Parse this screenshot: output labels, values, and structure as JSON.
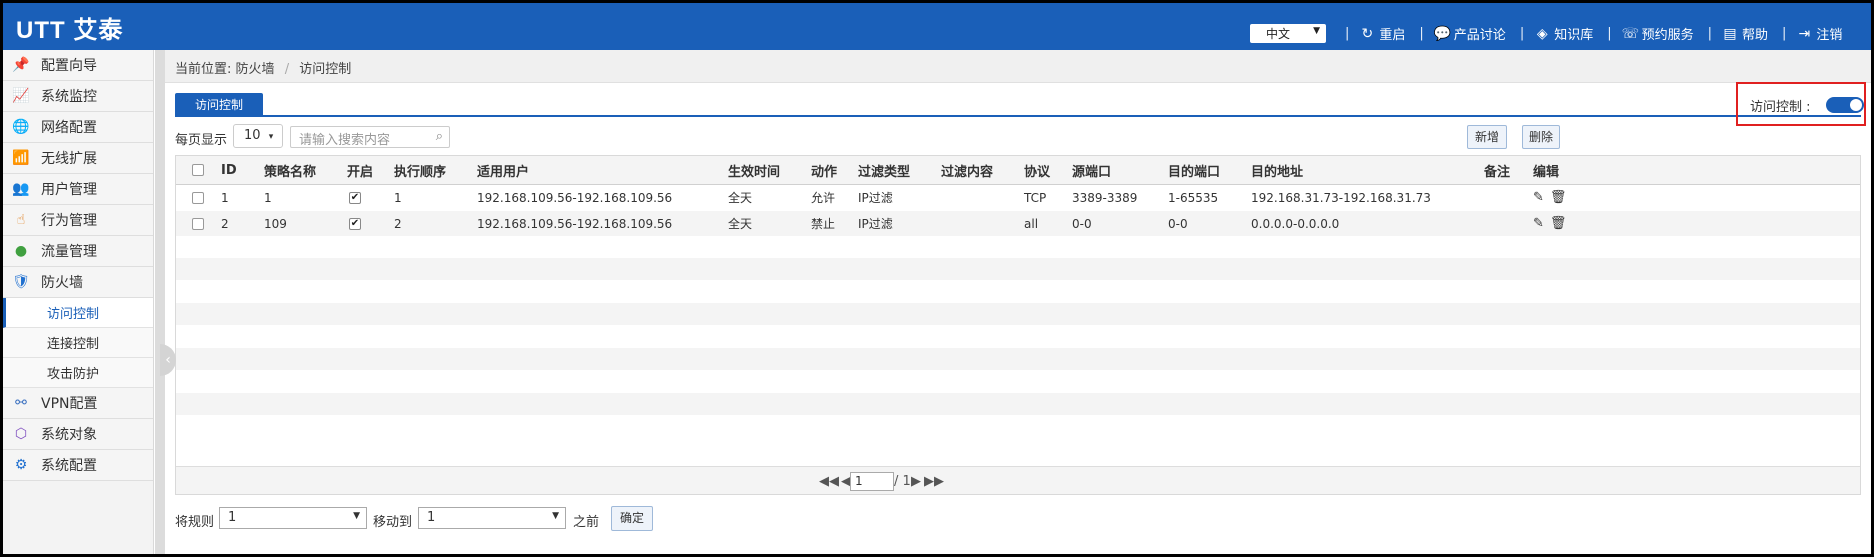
{
  "header": {
    "logo": "UTT 艾泰",
    "language": "中文",
    "nav": [
      {
        "label": "重启",
        "icon": "restart-icon",
        "glyph": "↻"
      },
      {
        "label": "产品讨论",
        "icon": "chat-icon",
        "glyph": "💬"
      },
      {
        "label": "知识库",
        "icon": "layers-icon",
        "glyph": "◈"
      },
      {
        "label": "预约服务",
        "icon": "service-icon",
        "glyph": "☏"
      },
      {
        "label": "帮助",
        "icon": "help-book-icon",
        "glyph": "▤"
      },
      {
        "label": "注销",
        "icon": "logout-icon",
        "glyph": "⇥"
      }
    ]
  },
  "sidebar": {
    "items": [
      {
        "label": "配置向导",
        "icon": "wizard-icon",
        "glyph": "📌",
        "color": "#e04020"
      },
      {
        "label": "系统监控",
        "icon": "monitor-icon",
        "glyph": "📈",
        "color": "#e0a020"
      },
      {
        "label": "网络配置",
        "icon": "globe-icon",
        "glyph": "🌐",
        "color": "#2050a0"
      },
      {
        "label": "无线扩展",
        "icon": "wireless-icon",
        "glyph": "📶",
        "color": "#e06020"
      },
      {
        "label": "用户管理",
        "icon": "users-icon",
        "glyph": "👥",
        "color": "#3a60c0"
      },
      {
        "label": "行为管理",
        "icon": "hand-icon",
        "glyph": "☝",
        "color": "#e08020"
      },
      {
        "label": "流量管理",
        "icon": "traffic-icon",
        "glyph": "●",
        "color": "#40a040"
      },
      {
        "label": "防火墙",
        "icon": "shield-icon",
        "glyph": "🛡",
        "color": "#2070d0"
      }
    ],
    "sub_items": [
      "访问控制",
      "连接控制",
      "攻击防护"
    ],
    "items_after": [
      {
        "label": "VPN配置",
        "icon": "vpn-icon",
        "glyph": "⚯",
        "color": "#3a70c0"
      },
      {
        "label": "系统对象",
        "icon": "cube-icon",
        "glyph": "⬡",
        "color": "#8050c0"
      },
      {
        "label": "系统配置",
        "icon": "gear-icon",
        "glyph": "⚙",
        "color": "#2070d0"
      }
    ]
  },
  "breadcrumb": {
    "prefix": "当前位置:",
    "section": "防火墙",
    "page": "访问控制"
  },
  "tab": {
    "label": "访问控制"
  },
  "toggle": {
    "label": "访问控制 :",
    "state": "on"
  },
  "toolbar": {
    "per_page_label": "每页显示",
    "per_page_value": "10",
    "search_placeholder": "请输入搜索内容",
    "add_label": "新增",
    "delete_label": "删除"
  },
  "table": {
    "columns": [
      "ID",
      "策略名称",
      "开启",
      "执行顺序",
      "适用用户",
      "生效时间",
      "动作",
      "过滤类型",
      "过滤内容",
      "协议",
      "源端口",
      "目的端口",
      "目的地址",
      "备注",
      "编辑"
    ],
    "rows": [
      {
        "id": "1",
        "name": "1",
        "enabled": true,
        "order": "1",
        "users": "192.168.109.56-192.168.109.56",
        "time": "全天",
        "action": "允许",
        "filter_type": "IP过滤",
        "filter_content": "",
        "protocol": "TCP",
        "src_port": "3389-3389",
        "dst_port": "1-65535",
        "dst_addr": "192.168.31.73-192.168.31.73",
        "note": ""
      },
      {
        "id": "2",
        "name": "109",
        "enabled": true,
        "order": "2",
        "users": "192.168.109.56-192.168.109.56",
        "time": "全天",
        "action": "禁止",
        "filter_type": "IP过滤",
        "filter_content": "",
        "protocol": "all",
        "src_port": "0-0",
        "dst_port": "0-0",
        "dst_addr": "0.0.0.0-0.0.0.0",
        "note": ""
      }
    ]
  },
  "pager": {
    "current": "1",
    "total": "/ 1"
  },
  "bottom": {
    "move_rule_label": "将规则",
    "rule_value": "1",
    "move_to_label": "移动到",
    "target_value": "1",
    "before_label": "之前",
    "confirm_label": "确定"
  }
}
